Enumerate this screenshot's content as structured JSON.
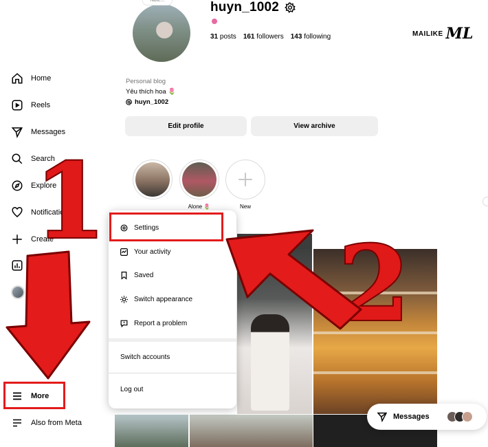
{
  "sidebar": {
    "items": [
      {
        "label": "Home",
        "icon": "home-icon"
      },
      {
        "label": "Reels",
        "icon": "reels-icon"
      },
      {
        "label": "Messages",
        "icon": "send-icon"
      },
      {
        "label": "Search",
        "icon": "search-icon"
      },
      {
        "label": "Explore",
        "icon": "compass-icon"
      },
      {
        "label": "Notifications",
        "icon": "heart-icon"
      },
      {
        "label": "Create",
        "icon": "plus-icon"
      },
      {
        "label": "Dashboard",
        "icon": "dashboard-icon"
      },
      {
        "label": "Profile",
        "icon": "avatar"
      }
    ],
    "more_label": "More",
    "also_from_meta_label": "Also from Meta"
  },
  "profile": {
    "note": "Note...",
    "username": "huyn_1002",
    "posts_count": "31",
    "posts_label": "posts",
    "followers_count": "161",
    "followers_label": "followers",
    "following_count": "143",
    "following_label": "following",
    "category": "Personal blog",
    "bio": "Yêu thích hoa 🌷",
    "threads_handle": "huyn_1002",
    "edit_profile_label": "Edit profile",
    "view_archive_label": "View archive"
  },
  "highlights": [
    {
      "label": ""
    },
    {
      "label": "Alone 🌷"
    },
    {
      "label": "New"
    }
  ],
  "menu": {
    "items": [
      {
        "label": "Settings",
        "icon": "settings-icon"
      },
      {
        "label": "Your activity",
        "icon": "activity-icon"
      },
      {
        "label": "Saved",
        "icon": "bookmark-icon"
      },
      {
        "label": "Switch appearance",
        "icon": "sun-icon"
      },
      {
        "label": "Report a problem",
        "icon": "report-icon"
      }
    ],
    "switch_accounts_label": "Switch accounts",
    "log_out_label": "Log out"
  },
  "messages_pill": {
    "label": "Messages"
  },
  "watermark": {
    "text": "MAILIKE",
    "logo": "ML"
  },
  "annotations": {
    "step1": "1",
    "step2": "2"
  },
  "colors": {
    "annotation_red": "#e31b1b",
    "button_bg": "#efefef"
  }
}
